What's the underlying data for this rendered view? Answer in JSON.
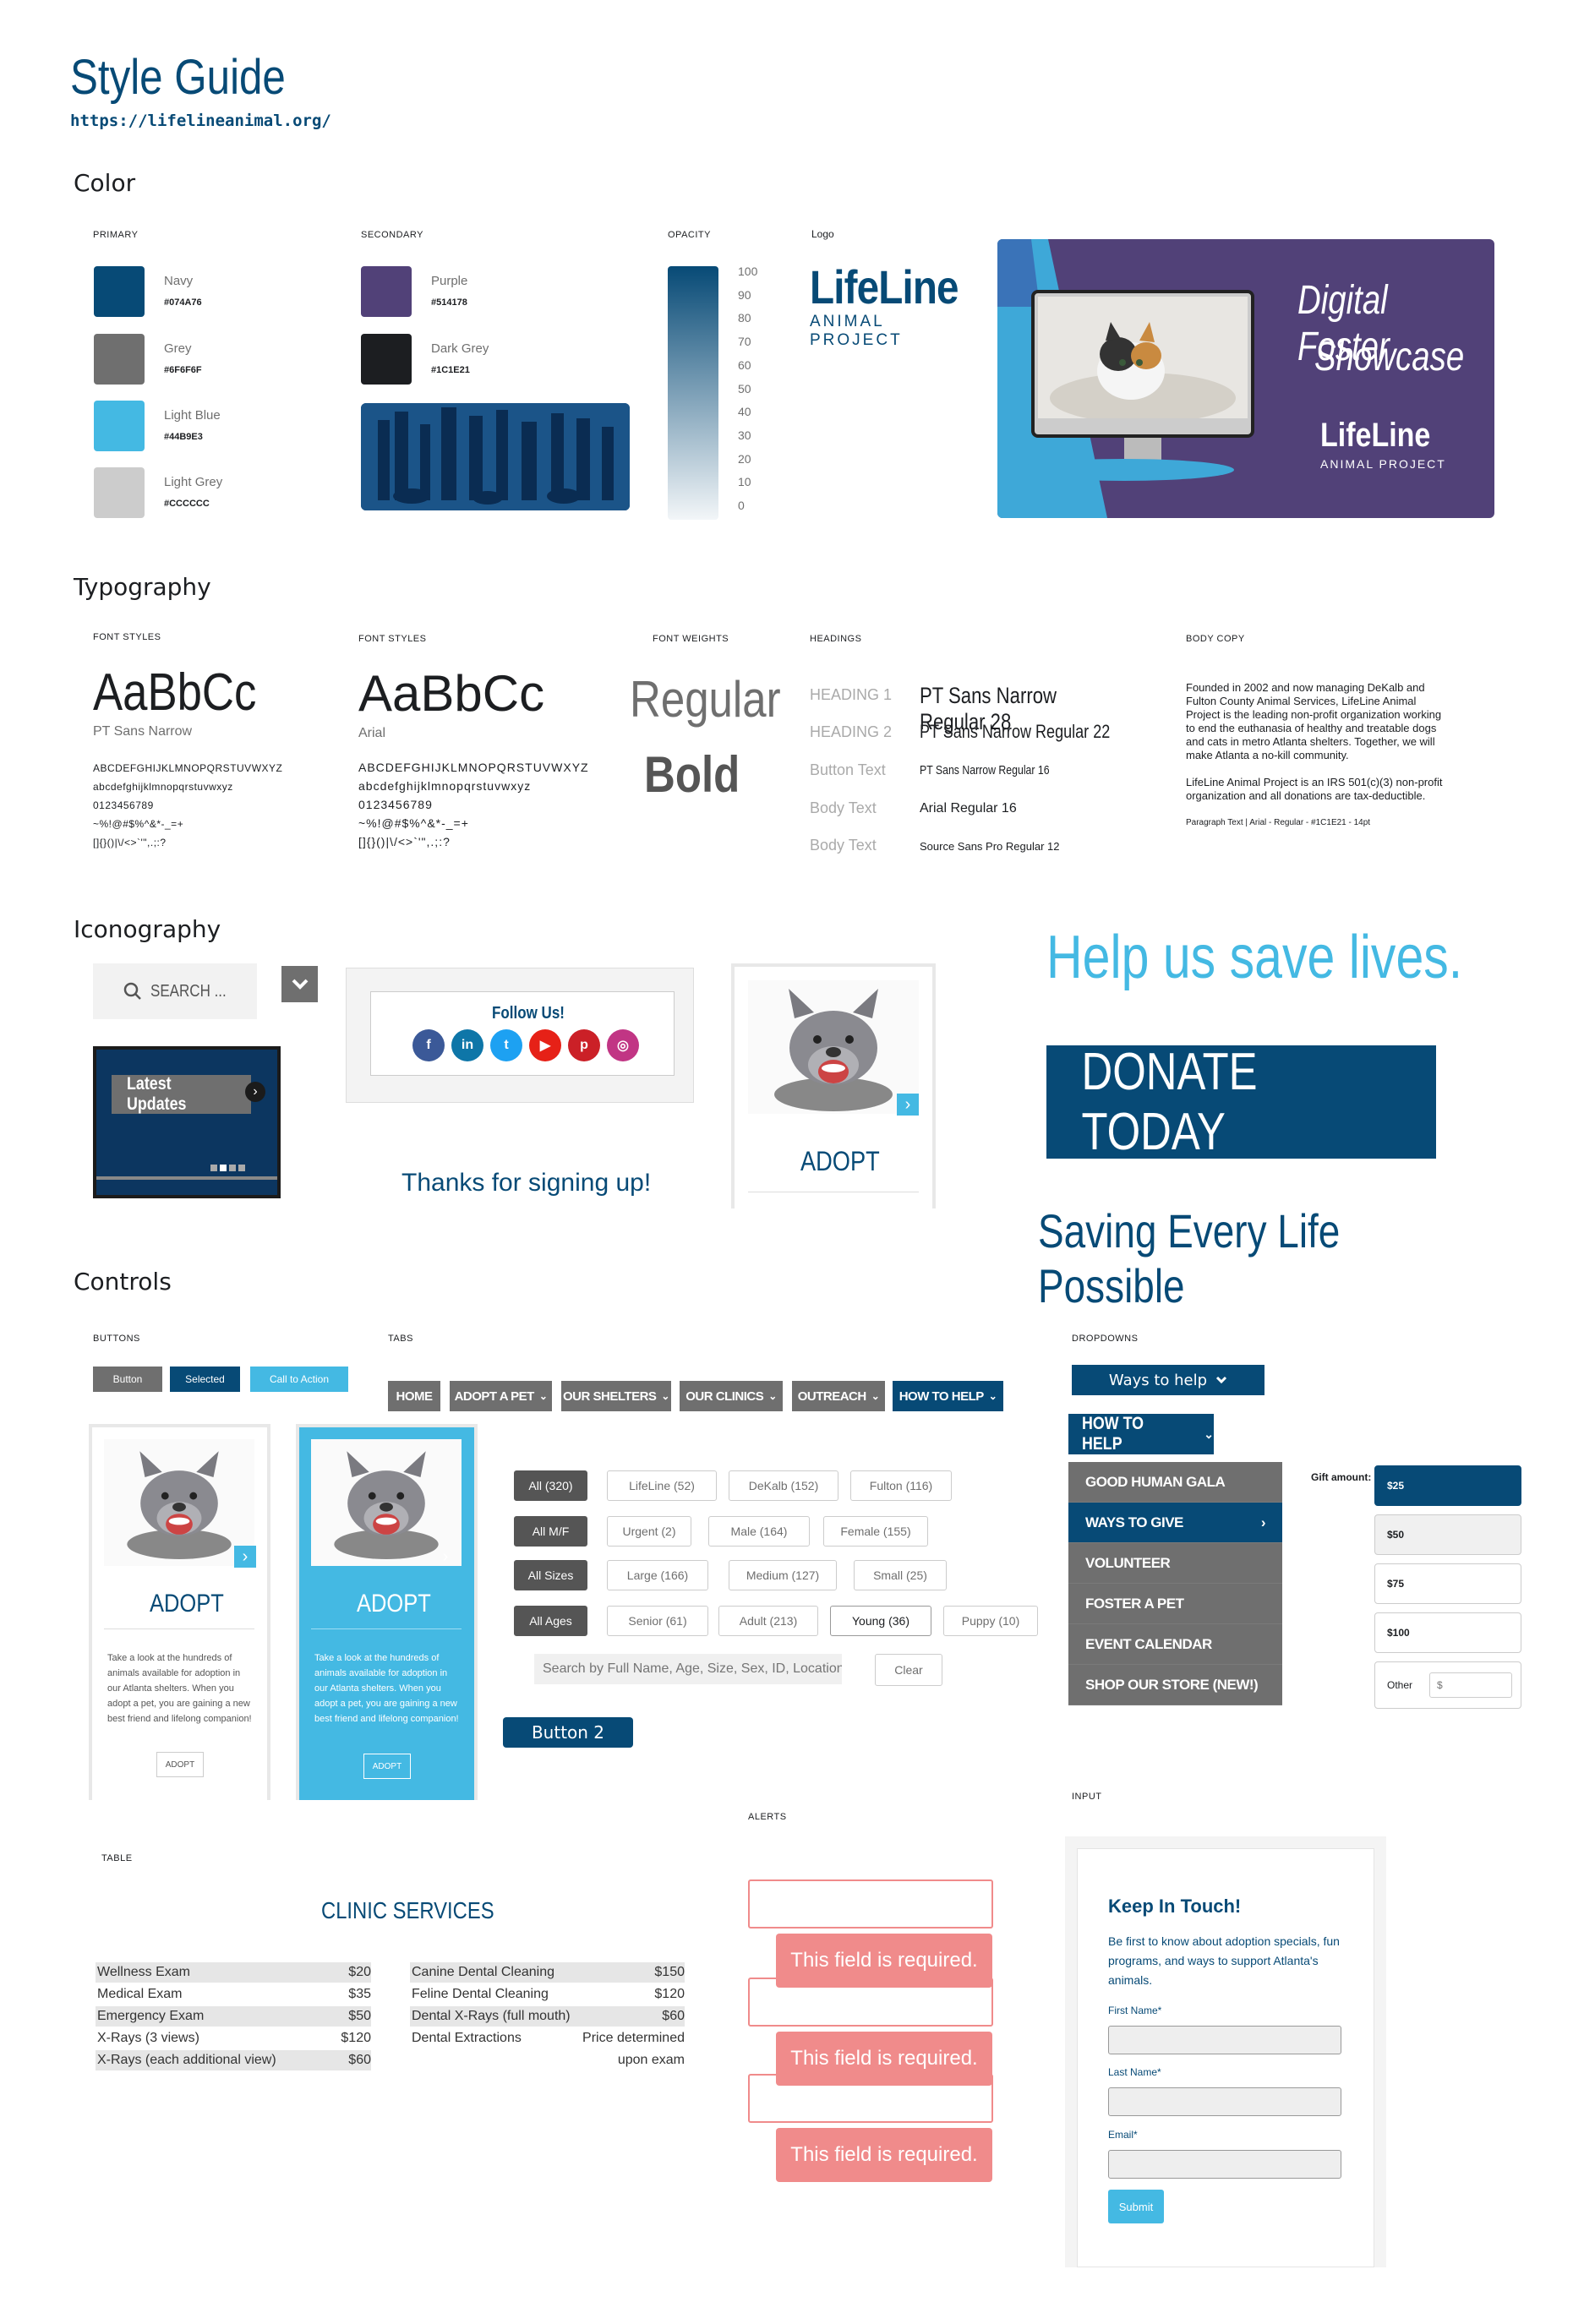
{
  "header": {
    "title": "Style Guide",
    "url": "https://lifelineanimal.org/"
  },
  "sections": {
    "color": "Color",
    "typography": "Typography",
    "iconography": "Iconography",
    "controls": "Controls"
  },
  "color": {
    "primary_label": "PRIMARY",
    "secondary_label": "SECONDARY",
    "opacity_label": "OPACITY",
    "logo_label": "Logo",
    "primary": [
      {
        "name": "Navy",
        "hex": "#074A76"
      },
      {
        "name": "Grey",
        "hex": "#6F6F6F"
      },
      {
        "name": "Light Blue",
        "hex": "#44B9E3"
      },
      {
        "name": "Light Grey",
        "hex": "#CCCCCC"
      }
    ],
    "secondary": [
      {
        "name": "Purple",
        "hex": "#514178"
      },
      {
        "name": "Dark Grey",
        "hex": "#1C1E21"
      }
    ],
    "opacity_ticks": [
      "100",
      "90",
      "80",
      "70",
      "60",
      "50",
      "40",
      "30",
      "20",
      "10",
      "0"
    ],
    "logo": {
      "word": "LifeLine",
      "sub": "ANIMAL PROJECT"
    },
    "showcase": {
      "line1": "Digital Foster",
      "line2": "Showcase",
      "logo_word": "LifeLine",
      "logo_sub": "ANIMAL PROJECT"
    }
  },
  "typography": {
    "font_styles_label": "FONT STYLES",
    "font_weights_label": "FONT WEIGHTS",
    "headings_label": "HEADINGS",
    "body_copy_label": "BODY COPY",
    "sample": "AaBbCc",
    "font1": "PT Sans Narrow",
    "font2": "Arial",
    "glyphs": [
      "ABCDEFGHIJKLMNOPQRSTUVWXYZ",
      "abcdefghijklmnopqrstuvwxyz",
      "0123456789",
      "~%!@#$%^&*-_=+",
      "[]{}()|\\/<>`'\",.;:?"
    ],
    "weights": [
      "Regular",
      "Bold"
    ],
    "headings": [
      {
        "label": "HEADING 1",
        "sample": "PT Sans Narrow Regular 28"
      },
      {
        "label": "HEADING 2",
        "sample": "PT Sans Narrow Regular 22"
      },
      {
        "label": "Button Text",
        "sample": "PT Sans Narrow Regular 16"
      },
      {
        "label": "Body Text",
        "sample": "Arial Regular 16"
      },
      {
        "label": "Body Text",
        "sample": "Source Sans Pro Regular 12"
      }
    ],
    "body_p1": "Founded in 2002 and now managing DeKalb and Fulton County Animal Services, LifeLine Animal Project is the leading non-profit organization working to end the euthanasia of healthy and treatable dogs and cats in metro Atlanta shelters. Together, we will make Atlanta a no-kill community.",
    "body_p2": "LifeLine Animal Project is an IRS 501(c)(3) non-profit organization and all donations are tax-deductible.",
    "body_caption": "Paragraph Text | Arial - Regular - #1C1E21 - 14pt"
  },
  "iconography": {
    "search_placeholder": "SEARCH ...",
    "latest_updates": "Latest Updates",
    "follow_us": "Follow Us!",
    "social": [
      {
        "icon": "facebook-icon",
        "color": "#3b5998",
        "glyph": "f"
      },
      {
        "icon": "linkedin-icon",
        "color": "#0e76a8",
        "glyph": "in"
      },
      {
        "icon": "twitter-icon",
        "color": "#1da1f2",
        "glyph": "t"
      },
      {
        "icon": "youtube-icon",
        "color": "#e62117",
        "glyph": "▶"
      },
      {
        "icon": "pinterest-icon",
        "color": "#cb2027",
        "glyph": "p"
      },
      {
        "icon": "instagram-icon",
        "color": "#c13584",
        "glyph": "◎"
      }
    ],
    "thanks": "Thanks for signing up!",
    "adopt": "ADOPT",
    "help_headline": "Help us save lives.",
    "donate": "DONATE TODAY",
    "saving": "Saving Every Life Possible"
  },
  "controls": {
    "buttons_label": "BUTTONS",
    "tabs_label": "TABS",
    "dropdowns_label": "DROPDOWNS",
    "buttons": [
      "Button",
      "Selected",
      "Call to Action"
    ],
    "tabs": [
      "HOME",
      "ADOPT A PET",
      "OUR SHELTERS",
      "OUR CLINICS",
      "OUTREACH",
      "HOW TO HELP"
    ],
    "ways_to_help": "Ways to help",
    "how_to_help": "HOW TO HELP",
    "menu": [
      "GOOD HUMAN GALA",
      "WAYS TO GIVE",
      "VOLUNTEER",
      "FOSTER A PET",
      "EVENT CALENDAR",
      "SHOP OUR STORE (NEW!)"
    ],
    "gift_label": "Gift amount:",
    "gifts": [
      "$25",
      "$50",
      "$75",
      "$100"
    ],
    "gift_other": "Other",
    "gift_placeholder": "$",
    "adopt_card": {
      "title": "ADOPT",
      "text": "Take a look at the hundreds of animals available for adoption in our Atlanta shelters. When you adopt a pet, you are gaining a new best friend and lifelong companion!",
      "button": "ADOPT"
    },
    "filter_rows": [
      [
        "All (320)",
        "LifeLine (52)",
        "DeKalb (152)",
        "Fulton (116)"
      ],
      [
        "All M/F",
        "Urgent (2)",
        "Male (164)",
        "Female (155)"
      ],
      [
        "All Sizes",
        "Large (166)",
        "Medium (127)",
        "Small (25)"
      ],
      [
        "All Ages",
        "Senior (61)",
        "Adult (213)",
        "Young (36)",
        "Puppy (10)"
      ]
    ],
    "search_placeholder": "Search by Full Name, Age, Size, Sex, ID, Location",
    "clear": "Clear",
    "button2": "Button 2"
  },
  "table": {
    "label": "TABLE",
    "title": "CLINIC SERVICES",
    "left": [
      [
        "Wellness Exam",
        "$20"
      ],
      [
        "Medical Exam",
        "$35"
      ],
      [
        "Emergency Exam",
        "$50"
      ],
      [
        "X-Rays (3 views)",
        "$120"
      ],
      [
        "X-Rays (each additional view)",
        "$60"
      ]
    ],
    "right": [
      [
        "Canine Dental Cleaning",
        "$150"
      ],
      [
        "Feline Dental Cleaning",
        "$120"
      ],
      [
        "Dental X-Rays (full mouth)",
        "$60"
      ],
      [
        "Dental Extractions",
        "Price determined"
      ],
      [
        "",
        "upon exam"
      ]
    ]
  },
  "alerts": {
    "label": "ALERTS",
    "message": "This field is required."
  },
  "input": {
    "label": "INPUT",
    "title": "Keep In Touch!",
    "text": "Be first to know about adoption specials, fun programs, and ways to support Atlanta's animals.",
    "first": "First Name*",
    "last": "Last Name*",
    "email": "Email*",
    "submit": "Submit"
  }
}
